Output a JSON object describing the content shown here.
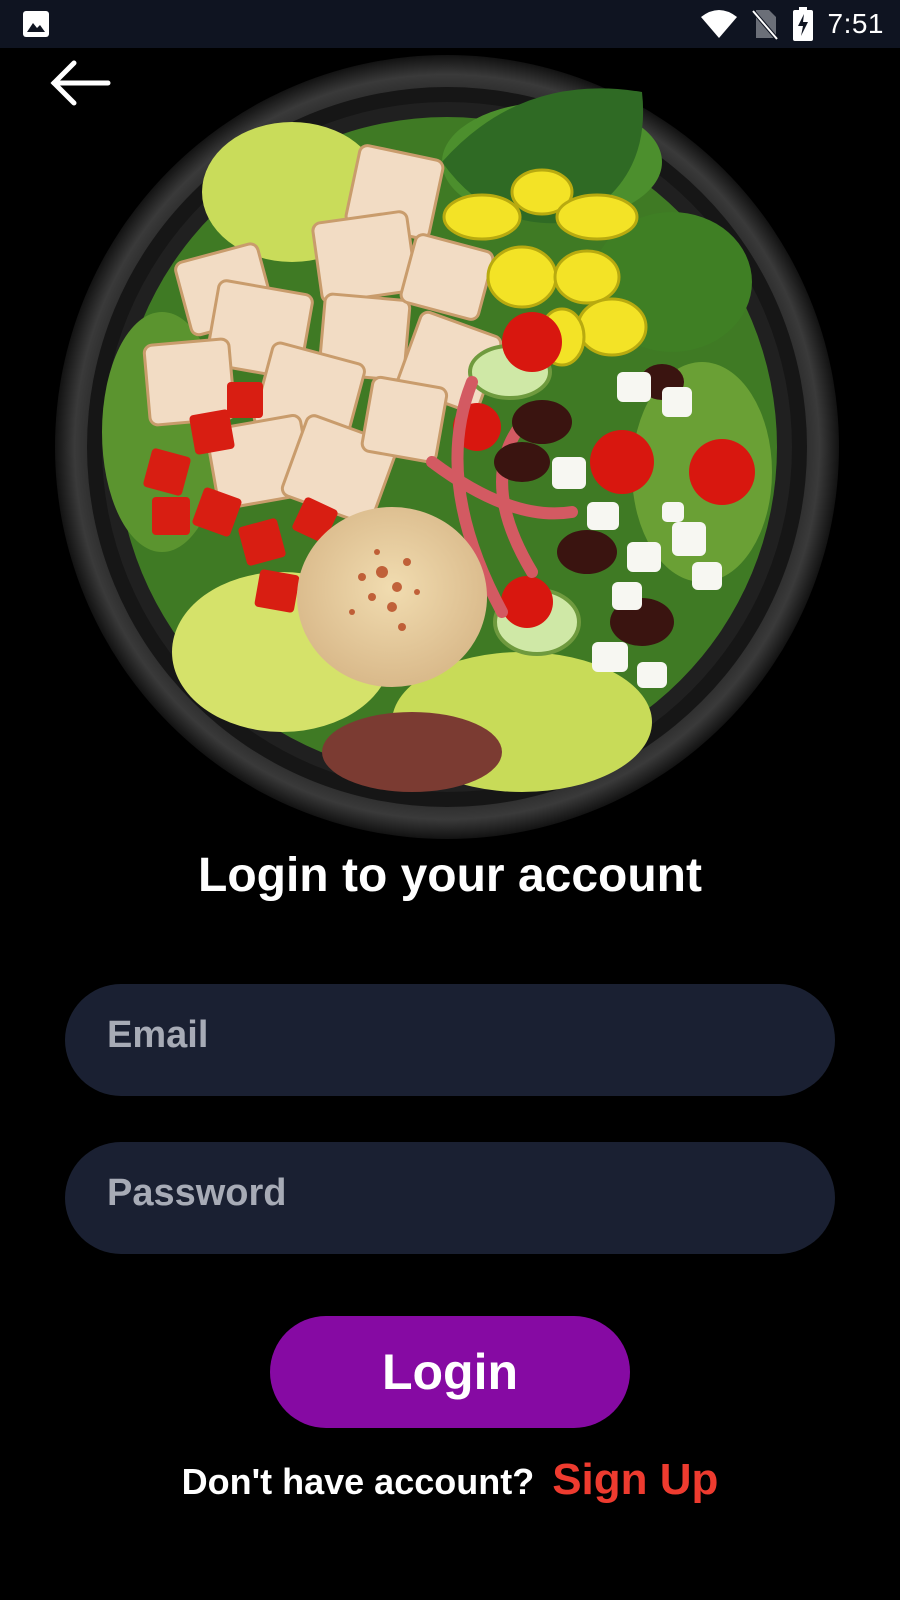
{
  "status_bar": {
    "time": "7:51",
    "icons": [
      "gallery-icon",
      "wifi-icon",
      "no-sim-icon",
      "battery-charging-icon"
    ]
  },
  "nav": {
    "back_icon": "arrow-left-icon"
  },
  "hero": {
    "image": "salad-bowl-illustration"
  },
  "login": {
    "title": "Login to your account",
    "email_placeholder": "Email",
    "email_value": "",
    "password_placeholder": "Password",
    "password_value": "",
    "button_label": "Login"
  },
  "footer": {
    "prompt": "Don't have account?",
    "signup_label": "Sign Up"
  },
  "colors": {
    "background": "#000000",
    "status_bar": "#0f1421",
    "input_background": "#1a2032",
    "placeholder": "#a7abb6",
    "primary_button": "#860aa3",
    "signup_link": "#ee3b2f",
    "text": "#ffffff"
  }
}
